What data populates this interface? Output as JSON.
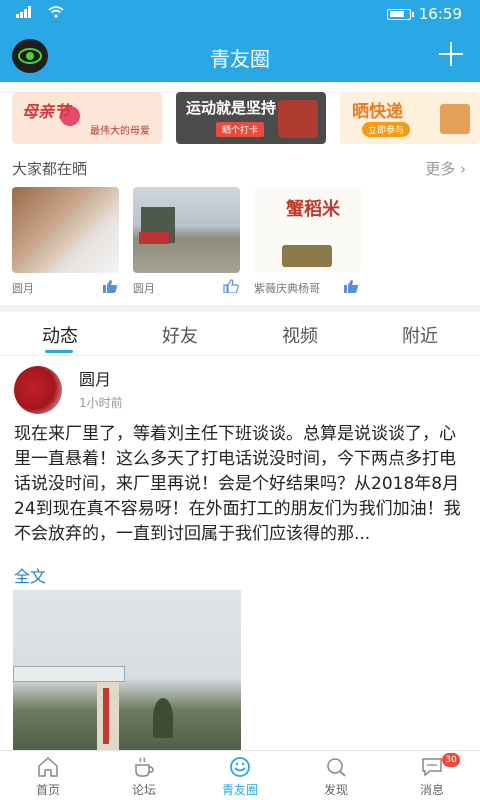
{
  "status_bar": {
    "time": "16:59"
  },
  "app_bar": {
    "title": "青友圈"
  },
  "banners": [
    {
      "title": "母亲节",
      "subtitle": "最伟大的母爱"
    },
    {
      "title": "运动就是坚持",
      "tag": "晒个打卡"
    },
    {
      "title": "晒快递",
      "tag": "立即参与"
    }
  ],
  "share_section": {
    "title": "大家都在晒",
    "more_label": "更多",
    "items": [
      {
        "author": "圆月"
      },
      {
        "author": "圆月"
      },
      {
        "author": "紫薇庆典杨哥",
        "image_title": "蟹稻米"
      }
    ]
  },
  "tabs": [
    {
      "label": "动态",
      "active": true
    },
    {
      "label": "好友",
      "active": false
    },
    {
      "label": "视频",
      "active": false
    },
    {
      "label": "附近",
      "active": false
    }
  ],
  "post": {
    "username": "圆月",
    "time": "1小时前",
    "text": "现在来厂里了，等着刘主任下班谈谈。总算是说谈谈了，心里一直悬着！这么多天了打电话说没时间，今下两点多打电话说没时间，来厂里再说！会是个好结果吗？从2018年8月24到现在真不容易呀！在外面打工的朋友们为我们加油！我不会放弃的，一直到讨回属于我们应该得的那...",
    "full_text_label": "全文"
  },
  "bottom_nav": [
    {
      "label": "首页",
      "icon": "home-icon"
    },
    {
      "label": "论坛",
      "icon": "coffee-icon"
    },
    {
      "label": "青友圈",
      "icon": "smile-icon",
      "active": true
    },
    {
      "label": "发现",
      "icon": "search-icon"
    },
    {
      "label": "消息",
      "icon": "chat-icon",
      "badge": "30"
    }
  ],
  "colors": {
    "accent": "#2aa8e6",
    "badge": "#e84a3c"
  }
}
